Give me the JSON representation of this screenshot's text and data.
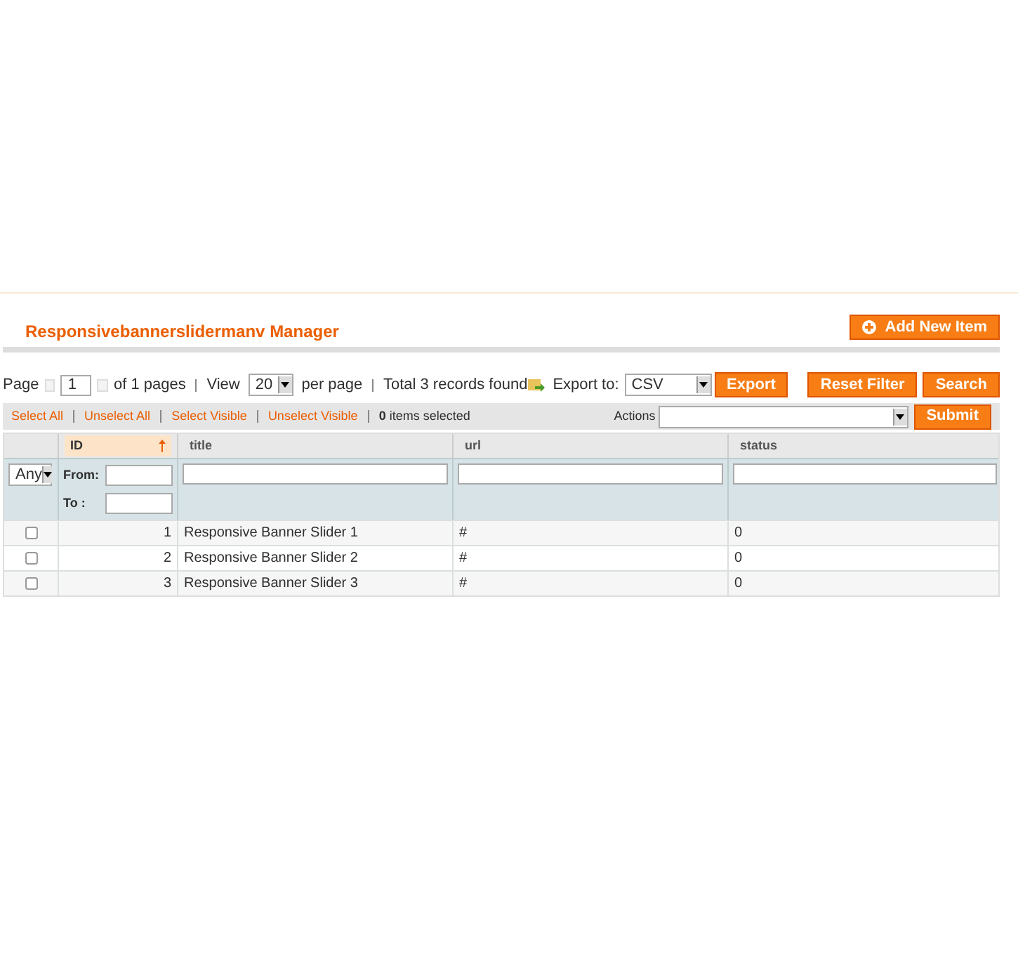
{
  "header": {
    "title": "Responsivebannerslidermanv Manager",
    "add_button": "Add New Item"
  },
  "pager": {
    "page_label": "Page",
    "page": "1",
    "of_pages": "of 1 pages",
    "view_label": "View",
    "per_page": "20",
    "per_page_label": "per page",
    "total": "Total 3 records found",
    "export_label": "Export to:",
    "export_format": "CSV",
    "export_button": "Export",
    "reset_button": "Reset Filter",
    "search_button": "Search"
  },
  "massaction": {
    "links": [
      "Select All",
      "Unselect All",
      "Select Visible",
      "Unselect Visible"
    ],
    "count": "0",
    "count_label": "items selected",
    "actions_label": "Actions",
    "submit": "Submit"
  },
  "columns": [
    {
      "label": "ID",
      "sorted": true
    },
    {
      "label": "title",
      "sorted": false
    },
    {
      "label": "url",
      "sorted": false
    },
    {
      "label": "status",
      "sorted": false
    }
  ],
  "filters": {
    "any": "Any",
    "from": "From:",
    "to": "To :"
  },
  "rows": [
    {
      "checked": false,
      "id": "1",
      "title": "Responsive Banner Slider 1",
      "url": "#",
      "status": "0"
    },
    {
      "checked": false,
      "id": "2",
      "title": "Responsive Banner Slider 2",
      "url": "#",
      "status": "0"
    },
    {
      "checked": false,
      "id": "3",
      "title": "Responsive Banner Slider 3",
      "url": "#",
      "status": "0"
    }
  ]
}
